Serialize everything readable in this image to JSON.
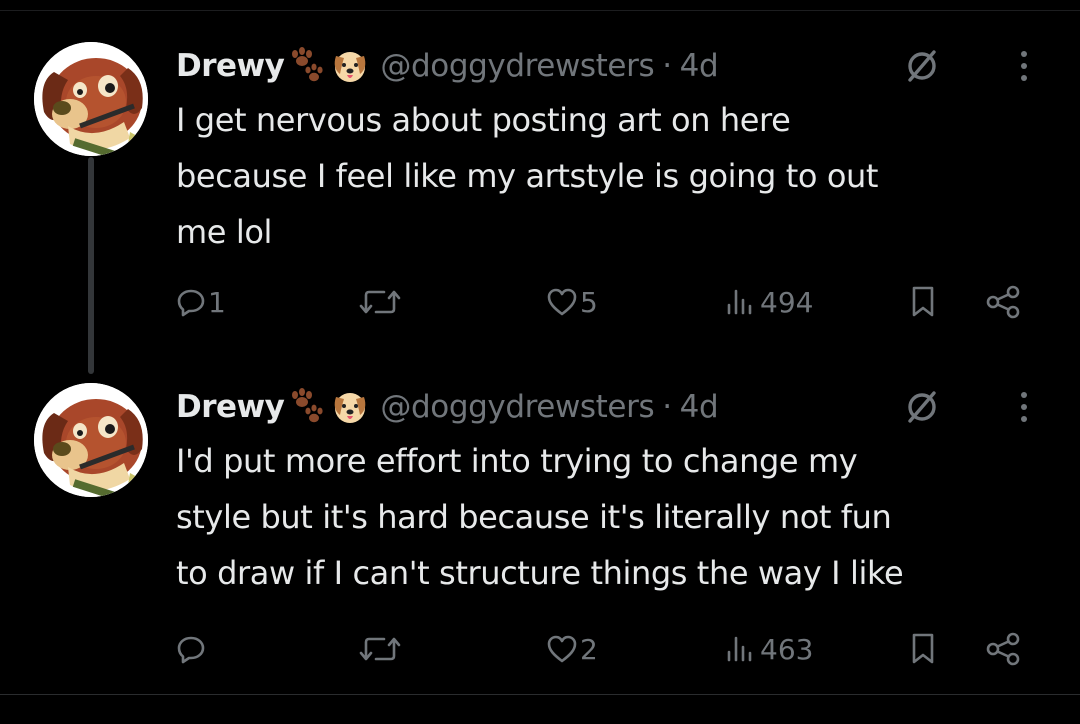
{
  "tweets": [
    {
      "display_name": "Drewy",
      "name_emojis": [
        "paw-prints-icon",
        "dog-face-icon"
      ],
      "handle": "@doggydrewsters",
      "separator": "·",
      "time": "4d",
      "text_lines": [
        "I get nervous about posting art on here",
        "because I feel like my artstyle is going to out",
        "me lol"
      ],
      "reply_count": "1",
      "retweet_count": "",
      "like_count": "5",
      "view_count": "494"
    },
    {
      "display_name": "Drewy",
      "name_emojis": [
        "paw-prints-icon",
        "dog-face-icon"
      ],
      "handle": "@doggydrewsters",
      "separator": "·",
      "time": "4d",
      "text_lines": [
        "I'd put more effort into trying to change my",
        "style but it's hard because it's literally not fun",
        "to draw if I can't structure things the way I like"
      ],
      "reply_count": "",
      "retweet_count": "",
      "like_count": "2",
      "view_count": "463"
    }
  ],
  "colors": {
    "background": "#000000",
    "text_primary": "#e7e9ea",
    "text_secondary": "#71767b",
    "thread_line": "#333639"
  }
}
